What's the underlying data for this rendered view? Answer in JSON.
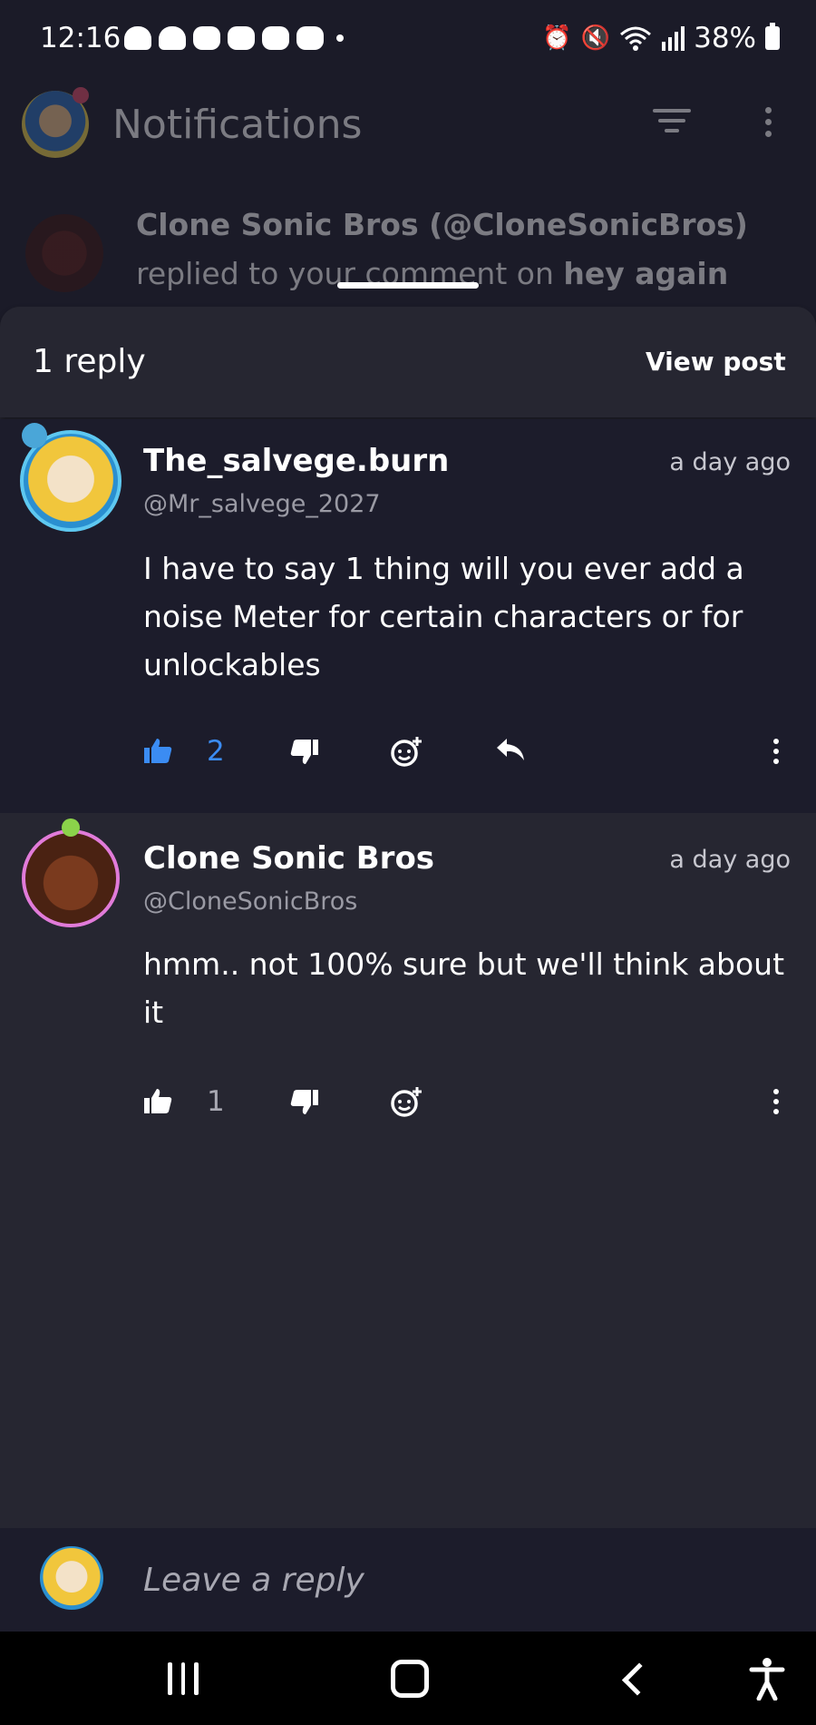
{
  "status_bar": {
    "time": "12:16",
    "battery": "38%",
    "left_icons": [
      "snapchat-icon",
      "snapchat-icon",
      "discord-icon",
      "discord-icon",
      "discord-icon",
      "discord-icon",
      "dot-icon"
    ],
    "right_icons": [
      "alarm-icon",
      "mute-icon",
      "wifi-icon",
      "signal-icon",
      "battery-icon"
    ]
  },
  "header": {
    "title": "Notifications"
  },
  "notification": {
    "author": "Clone Sonic Bros (@CloneSonicBros)",
    "action_text": "replied to your comment on ",
    "post_title": "hey again"
  },
  "sheet": {
    "reply_count": "1 reply",
    "view_post_label": "View post"
  },
  "comments": [
    {
      "name": "The_salvege.burn",
      "handle": "@Mr_salvege_2027",
      "time": "a day ago",
      "text": "I have to say 1 thing will you ever add a noise Meter for certain characters or for unlockables",
      "likes": "2",
      "liked": true,
      "like_color": "#3b8cf3"
    },
    {
      "name": "Clone Sonic Bros",
      "handle": "@CloneSonicBros",
      "time": "a day ago",
      "text": "hmm.. not 100% sure but we'll think about it",
      "likes": "1",
      "liked": false
    }
  ],
  "reply_input": {
    "placeholder": "Leave a reply"
  },
  "nav": {
    "buttons": [
      "recents-icon",
      "home-icon",
      "back-icon",
      "accessibility-icon"
    ]
  }
}
